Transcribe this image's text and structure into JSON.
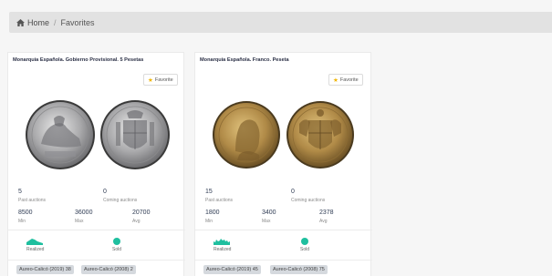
{
  "breadcrumb": {
    "home": "Home",
    "separator": "/",
    "current": "Favorites"
  },
  "cards": [
    {
      "title": "Monarquía Española. Gobierno Provisional. 5 Pesetas",
      "favorite_label": "Favorite",
      "past_auctions": "5",
      "past_auctions_label": "Past auctions",
      "coming_auctions": "0",
      "coming_auctions_label": "Coming auctions",
      "min": "8500",
      "min_label": "Min",
      "max": "36000",
      "max_label": "Max",
      "avg": "20700",
      "avg_label": "Avg",
      "realized_label": "Realized",
      "sold_label": "Sold",
      "tags": [
        "Aureo-Calicó (2019) 38",
        "Aureo-Calicó (2008) 2"
      ]
    },
    {
      "title": "Monarquía Española. Franco. Peseta",
      "favorite_label": "Favorite",
      "past_auctions": "15",
      "past_auctions_label": "Past auctions",
      "coming_auctions": "0",
      "coming_auctions_label": "Coming auctions",
      "min": "1800",
      "min_label": "Min",
      "max": "3400",
      "max_label": "Max",
      "avg": "2378",
      "avg_label": "Avg",
      "realized_label": "Realized",
      "sold_label": "Sold",
      "tags": [
        "Aureo-Calicó (2019) 45",
        "Aureo-Calicó (2008) 75"
      ]
    }
  ],
  "colors": {
    "accent": "#1fbf9f",
    "star": "#f0b400",
    "title": "#2a2f45"
  },
  "icons": [
    "home-icon",
    "star-icon",
    "realized-chart-icon",
    "sold-dot-icon"
  ]
}
